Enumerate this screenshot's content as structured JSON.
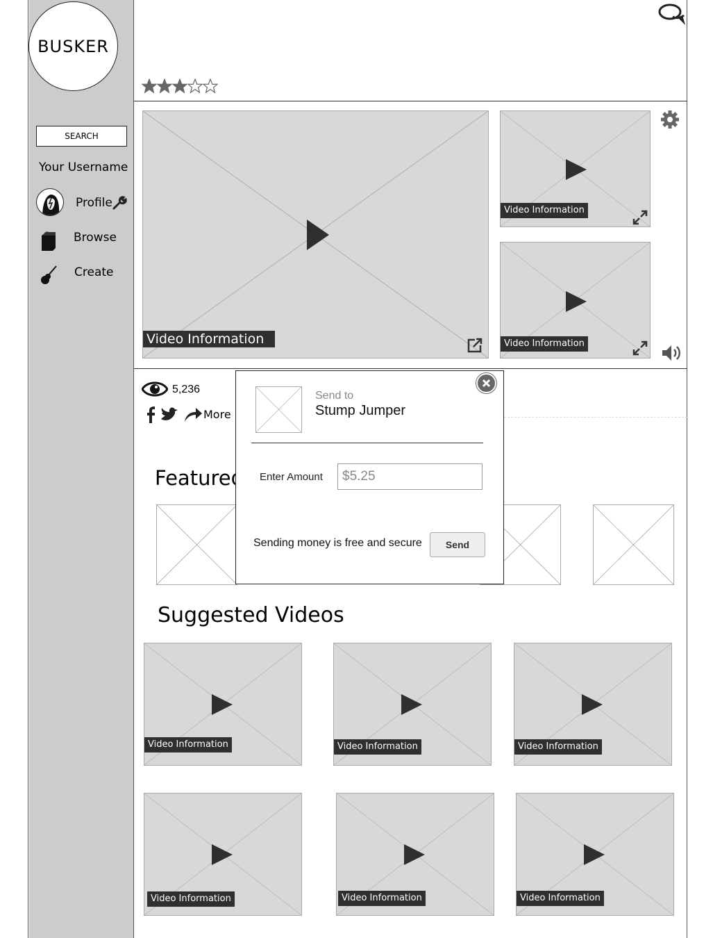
{
  "app": {
    "logo": "BUSKER"
  },
  "sidebar": {
    "search_label": "SEARCH",
    "username": "Your Username",
    "items": [
      {
        "label": "Profile",
        "icon": "avatar"
      },
      {
        "label": "Browse",
        "icon": "bag-icon"
      },
      {
        "label": "Create",
        "icon": "guitar-icon"
      }
    ]
  },
  "header": {
    "rating": 3,
    "rating_max": 5,
    "chat_icon": "chat-icon"
  },
  "player": {
    "main_video_info": "Video Information",
    "side_videos": [
      {
        "info": "Video Information"
      },
      {
        "info": "Video Information"
      }
    ],
    "icons": [
      "settings-gear-icon",
      "volume-icon",
      "expand-icon",
      "external-link-icon"
    ]
  },
  "stats": {
    "views": "5,236",
    "share_more": "More"
  },
  "modal": {
    "send_to_label": "Send to",
    "recipient": "Stump Jumper",
    "amount_label": "Enter Amount",
    "amount_value": "$5.25",
    "note": "Sending money is free and secure",
    "send_button": "Send"
  },
  "sections": {
    "featured_title": "Featured",
    "suggested_title": "Suggested Videos"
  },
  "suggested": [
    {
      "info": "Video Information"
    },
    {
      "info": "Video Information"
    },
    {
      "info": "Video Information"
    },
    {
      "info": "Video Information"
    },
    {
      "info": "Video Information"
    },
    {
      "info": "Video Information"
    }
  ]
}
